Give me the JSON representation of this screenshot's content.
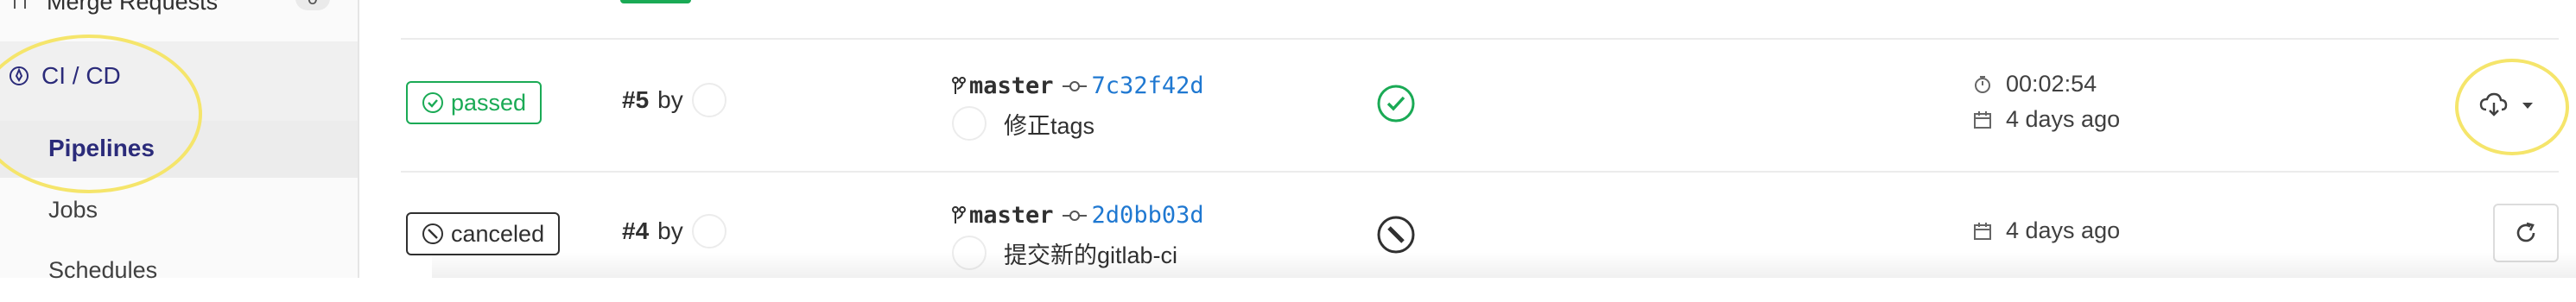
{
  "sidebar": {
    "merge_requests": {
      "label": "Merge Requests",
      "count": "0",
      "icon": "merge-request-icon"
    },
    "cicd": {
      "label": "CI / CD",
      "icon": "rocket-icon"
    },
    "items": [
      {
        "label": "Pipelines",
        "active": true
      },
      {
        "label": "Jobs"
      },
      {
        "label": "Schedules"
      }
    ]
  },
  "pipelines": [
    {
      "status": "passed",
      "status_color": "#1aaa55",
      "id": "#5",
      "by": "by",
      "branch": "master",
      "sha": "7c32f42d",
      "message": "修正tags",
      "stage_icon": "success-check-icon",
      "duration": "00:02:54",
      "finished": "4 days ago",
      "action_icon": "download-artifacts-icon"
    },
    {
      "status": "canceled",
      "status_color": "#303030",
      "id": "#4",
      "by": "by",
      "branch": "master",
      "sha": "2d0bb03d",
      "message": "提交新的gitlab-ci",
      "stage_icon": "canceled-icon",
      "finished": "4 days ago",
      "action_icon": "retry-icon"
    }
  ],
  "colors": {
    "accent": "#2b2b7a",
    "success": "#1aaa55",
    "link": "#1f78d1",
    "highlight": "#f5e56b"
  }
}
